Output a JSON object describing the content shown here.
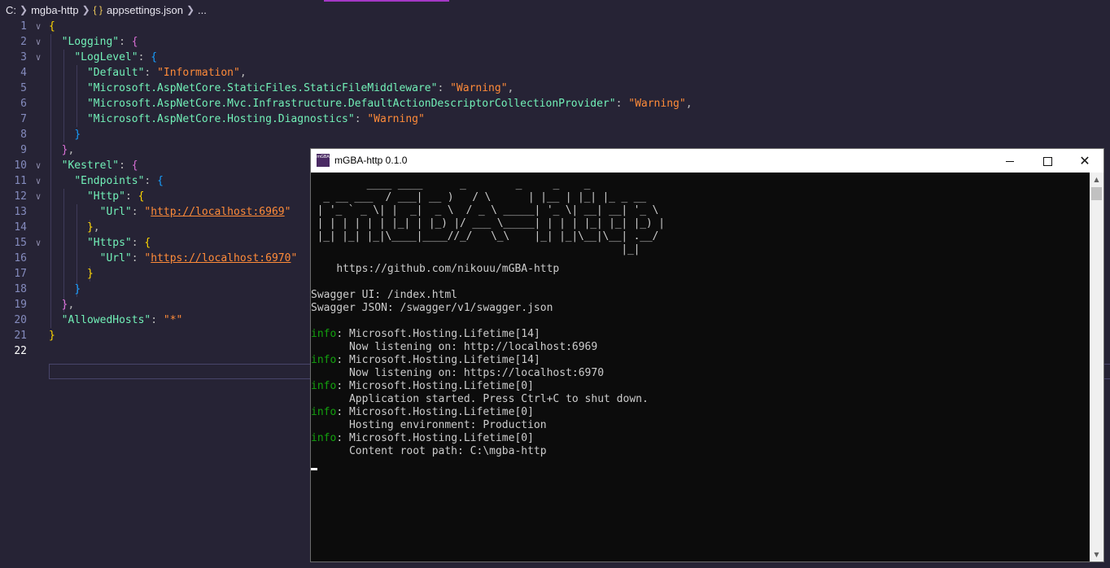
{
  "breadcrumb": {
    "root": "C:",
    "folder": "mgba-http",
    "json_icon": "{ }",
    "file": "appsettings.json",
    "more": "..."
  },
  "editor": {
    "line_numbers": [
      "1",
      "2",
      "3",
      "4",
      "5",
      "6",
      "7",
      "8",
      "9",
      "10",
      "11",
      "12",
      "13",
      "14",
      "15",
      "16",
      "17",
      "18",
      "19",
      "20",
      "21",
      "22"
    ],
    "code": {
      "keys": {
        "logging": "\"Logging\"",
        "loglevel": "\"LogLevel\"",
        "default": "\"Default\"",
        "staticfiles": "\"Microsoft.AspNetCore.StaticFiles.StaticFileMiddleware\"",
        "mvc": "\"Microsoft.AspNetCore.Mvc.Infrastructure.DefaultActionDescriptorCollectionProvider\"",
        "hosting": "\"Microsoft.AspNetCore.Hosting.Diagnostics\"",
        "kestrel": "\"Kestrel\"",
        "endpoints": "\"Endpoints\"",
        "http": "\"Http\"",
        "url1": "\"Url\"",
        "https": "\"Https\"",
        "url2": "\"Url\"",
        "allowedhosts": "\"AllowedHosts\""
      },
      "values": {
        "information": "\"Information\"",
        "warning1": "\"Warning\"",
        "warning2": "\"Warning\"",
        "warning3": "\"Warning\"",
        "http_q1": "\"",
        "http_url": "http://localhost:6969",
        "http_q2": "\"",
        "https_q1": "\"",
        "https_url": "https://localhost:6970",
        "https_q2": "\"",
        "star": "\"*\""
      }
    }
  },
  "console_window": {
    "title": "mGBA-http 0.1.0",
    "icon_label": "mGBA",
    "ascii_art": "         ____ ____      _        _     _    _\n  _ __ ___  / ___| __ )   / \\      | |__ | |_| |_ _ __\n | '_ ` _ \\| |  _|  _ \\  / _ \\ _____| '_ \\| __| __| '_ \\\n | | | | | | |_| | |_) |/ ___ \\_____| | | | |_| |_| |_) |\n |_| |_| |_|\\____|____//_/   \\_\\    |_| |_|\\__|\\__| .__/\n                                                  |_|",
    "github_url": "https://github.com/nikouu/mGBA-http",
    "swagger_ui": "Swagger UI: /index.html",
    "swagger_json": "Swagger JSON: /swagger/v1/swagger.json",
    "logs": [
      {
        "level": "info",
        "source": ": Microsoft.Hosting.Lifetime[14]",
        "message": "      Now listening on: http://localhost:6969"
      },
      {
        "level": "info",
        "source": ": Microsoft.Hosting.Lifetime[14]",
        "message": "      Now listening on: https://localhost:6970"
      },
      {
        "level": "info",
        "source": ": Microsoft.Hosting.Lifetime[0]",
        "message": "      Application started. Press Ctrl+C to shut down."
      },
      {
        "level": "info",
        "source": ": Microsoft.Hosting.Lifetime[0]",
        "message": "      Hosting environment: Production"
      },
      {
        "level": "info",
        "source": ": Microsoft.Hosting.Lifetime[0]",
        "message": "      Content root path: C:\\mgba-http"
      }
    ]
  },
  "colors": {
    "editor_bg": "#262335",
    "json_key": "#72f1b8",
    "json_string": "#ff8b39",
    "console_bg": "#0c0c0c",
    "info_green": "#13a10e"
  }
}
